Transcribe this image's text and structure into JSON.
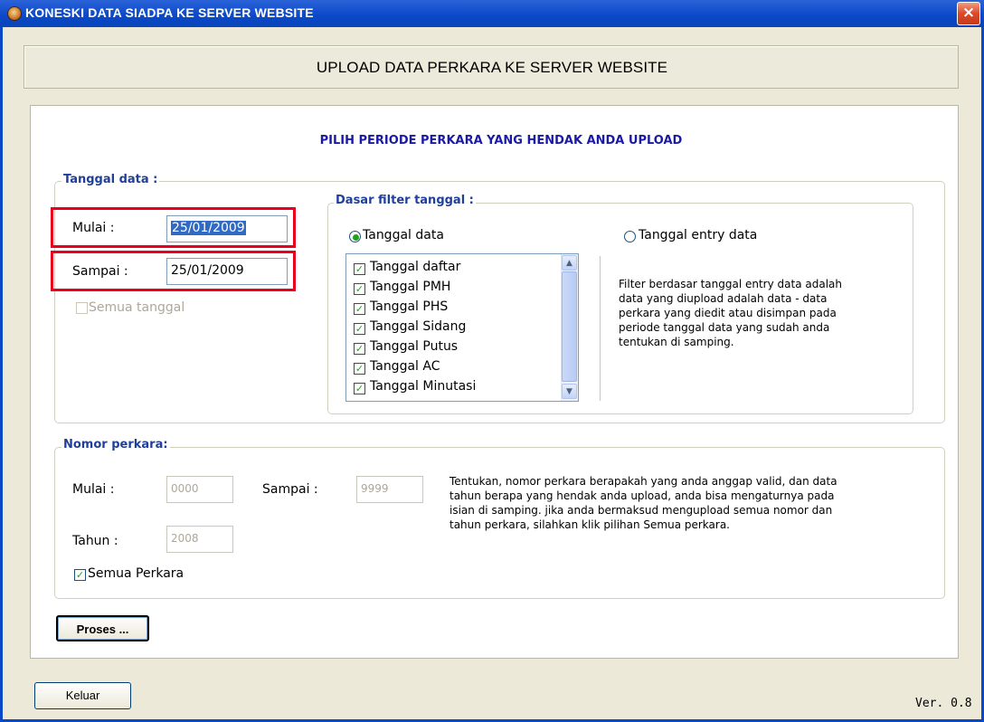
{
  "window": {
    "title": "KONESKI DATA SIADPA KE SERVER WEBSITE",
    "close_glyph": "×"
  },
  "header": {
    "title": "UPLOAD DATA PERKARA KE SERVER WEBSITE"
  },
  "instruction": "PILIH PERIODE PERKARA YANG HENDAK ANDA UPLOAD",
  "tanggal_data": {
    "legend": "Tanggal data :",
    "mulai_label": "Mulai :",
    "mulai_value": "25/01/2009",
    "sampai_label": "Sampai :",
    "sampai_value": "25/01/2009",
    "semua_label": "Semua tanggal",
    "semua_checked": false
  },
  "dasar_filter": {
    "legend": "Dasar filter tanggal :",
    "radio_tanggal_data": "Tanggal data",
    "radio_tanggal_entry": "Tanggal entry data",
    "selected": "Tanggal data",
    "list_items": [
      "Tanggal daftar",
      "Tanggal PMH",
      "Tanggal PHS",
      "Tanggal Sidang",
      "Tanggal Putus",
      "Tanggal AC",
      "Tanggal Minutasi"
    ],
    "info_lines": [
      "Filter berdasar tanggal entry data adalah",
      "data yang diupload adalah data - data",
      "perkara yang diedit atau disimpan pada",
      "periode tanggal data yang sudah anda",
      "tentukan di samping."
    ]
  },
  "nomor_perkara": {
    "legend": "Nomor perkara:",
    "mulai_label": "Mulai :",
    "mulai_value": "0000",
    "sampai_label": "Sampai :",
    "sampai_value": "9999",
    "tahun_label": "Tahun :",
    "tahun_value": "2008",
    "semua_label": "Semua Perkara",
    "semua_checked": true,
    "info_lines": [
      "Tentukan, nomor perkara berapakah yang anda anggap valid, dan data",
      "tahun berapa yang hendak anda upload, anda bisa mengaturnya pada",
      "isian di samping. jika anda bermaksud mengupload semua nomor dan",
      "tahun perkara, silahkan klik pilihan Semua perkara."
    ]
  },
  "buttons": {
    "proses": "Proses ...",
    "keluar": "Keluar"
  },
  "version": "Ver. 0.8"
}
